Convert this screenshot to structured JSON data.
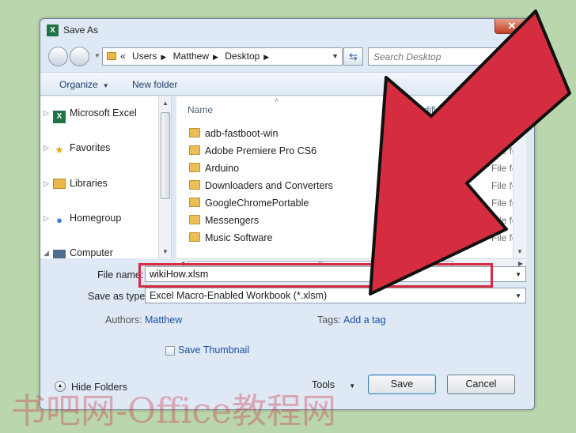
{
  "window": {
    "title": "Save As",
    "app_icon": "excel-icon",
    "close_glyph": "✕"
  },
  "address": {
    "crumbs": [
      "«",
      "Users",
      "Matthew",
      "Desktop"
    ],
    "search_placeholder": "Search Desktop"
  },
  "toolbar": {
    "organize": "Organize",
    "new_folder": "New folder",
    "help": "?"
  },
  "nav_pane": {
    "items": [
      {
        "label": "Microsoft Excel",
        "icon": "excel-icon"
      },
      {
        "label": "Favorites",
        "icon": "star-icon"
      },
      {
        "label": "Libraries",
        "icon": "library-icon"
      },
      {
        "label": "Homegroup",
        "icon": "homegroup-icon"
      },
      {
        "label": "Computer",
        "icon": "computer-icon"
      }
    ]
  },
  "file_list": {
    "columns": {
      "name": "Name",
      "modified": "modifi",
      "type": "Type"
    },
    "rows": [
      {
        "name": "adb-fastboot-win",
        "date": "",
        "type": "File fo"
      },
      {
        "name": "Adobe Premiere Pro CS6",
        "date": "",
        "type": "File fo"
      },
      {
        "name": "Arduino",
        "date": "",
        "type": "File fo"
      },
      {
        "name": "Downloaders and Converters",
        "date": "",
        "type": "File fo"
      },
      {
        "name": "GoogleChromePortable",
        "date": "",
        "type": "File fo"
      },
      {
        "name": "Messengers",
        "date": "M",
        "type": "File fo"
      },
      {
        "name": "Music Software",
        "date": "2:43 PM",
        "type": "File fo"
      }
    ],
    "hscroll_grip": "III"
  },
  "form": {
    "file_name_label": "File name:",
    "file_name_value": "wikiHow.xlsm",
    "save_type_label": "Save as type:",
    "save_type_value": "Excel Macro-Enabled Workbook (*.xlsm)",
    "authors_label": "Authors:",
    "authors_value": "Matthew",
    "tags_label": "Tags:",
    "tags_value": "Add a tag",
    "thumbnail_label": "Save Thumbnail"
  },
  "footer": {
    "hide_folders": "Hide Folders",
    "tools": "Tools",
    "save": "Save",
    "cancel": "Cancel"
  },
  "watermark": "书吧网-Office教程网",
  "colors": {
    "annotation_red": "#d62c3f",
    "background": "#b9d6ac"
  }
}
